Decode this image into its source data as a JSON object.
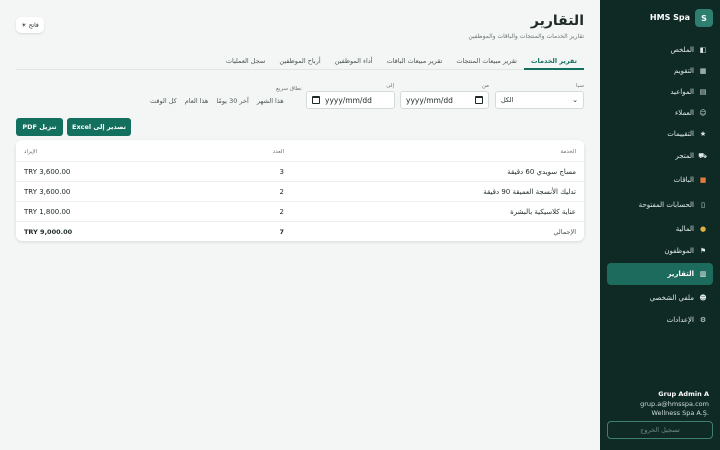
{
  "app": {
    "name": "HMS Spa",
    "logo_letter": "S"
  },
  "theme_toggle": {
    "label": "فاتح",
    "icon": "sun-icon"
  },
  "header": {
    "title": "التقارير",
    "subtitle": "تقارير الخدمات والمنتجات والباقات والموظفين"
  },
  "tabs": [
    {
      "label": "تقرير الخدمات",
      "active": true
    },
    {
      "label": "تقرير مبيعات المنتجات",
      "active": false
    },
    {
      "label": "تقرير مبيعات الباقات",
      "active": false
    },
    {
      "label": "أداء الموظفين",
      "active": false
    },
    {
      "label": "أرباح الموظفين",
      "active": false
    },
    {
      "label": "سجل العمليات",
      "active": false
    }
  ],
  "filters": {
    "spa_label": "سبا",
    "spa_value": "الكل",
    "from_label": "من",
    "from_placeholder": "yyyy/mm/dd",
    "to_label": "إلى",
    "to_placeholder": "yyyy/mm/dd",
    "quick_label": "نطاق سريع",
    "quick_ranges": [
      "هذا الشهر",
      "آخر 30 يومًا",
      "هذا العام",
      "كل الوقت"
    ]
  },
  "actions": {
    "export_excel": "تصدير إلى Excel",
    "download_pdf": "تنزيل PDF"
  },
  "table": {
    "columns": {
      "service": "الخدمة",
      "qty": "العدد",
      "revenue": "الإيراد"
    },
    "rows": [
      {
        "service": "مساج سويدي 60 دقيقة",
        "qty": "3",
        "revenue": "TRY 3,600.00"
      },
      {
        "service": "تدليك الأنسجة العميقة 90 دقيقة",
        "qty": "2",
        "revenue": "TRY 3,600.00"
      },
      {
        "service": "عناية كلاسيكية بالبشرة",
        "qty": "2",
        "revenue": "TRY 1,800.00"
      }
    ],
    "total": {
      "label": "الإجمالي",
      "qty": "7",
      "revenue": "TRY 9,000.00"
    }
  },
  "sidebar": {
    "items": [
      {
        "label": "الملخص",
        "icon": "dashboard-icon",
        "active": false
      },
      {
        "label": "التقويم",
        "icon": "calendar-icon",
        "active": false
      },
      {
        "label": "المواعيد",
        "icon": "appointments-icon",
        "active": false
      },
      {
        "label": "العملاء",
        "icon": "clients-icon",
        "active": false
      },
      {
        "label": "التقييمات",
        "icon": "star-icon",
        "active": false
      },
      {
        "label": "المتجر",
        "icon": "cart-icon",
        "active": false
      },
      {
        "label": "الباقات",
        "icon": "package-icon",
        "active": false
      },
      {
        "label": "الحسابات المفتوحة",
        "icon": "receipt-icon",
        "active": false
      },
      {
        "label": "المالية",
        "icon": "money-bag-icon",
        "active": false
      },
      {
        "label": "الموظفون",
        "icon": "flag-icon",
        "active": false
      },
      {
        "label": "التقارير",
        "icon": "chart-icon",
        "active": true
      },
      {
        "label": "ملفي الشخصي",
        "icon": "user-icon",
        "active": false
      },
      {
        "label": "الإعدادات",
        "icon": "gear-icon",
        "active": false
      }
    ]
  },
  "user": {
    "name": "Grup Admin A",
    "email": "grup.a@hmsspa.com",
    "company": "Wellness Spa A.Ş."
  },
  "logout_label": "تسجيل الخروج"
}
